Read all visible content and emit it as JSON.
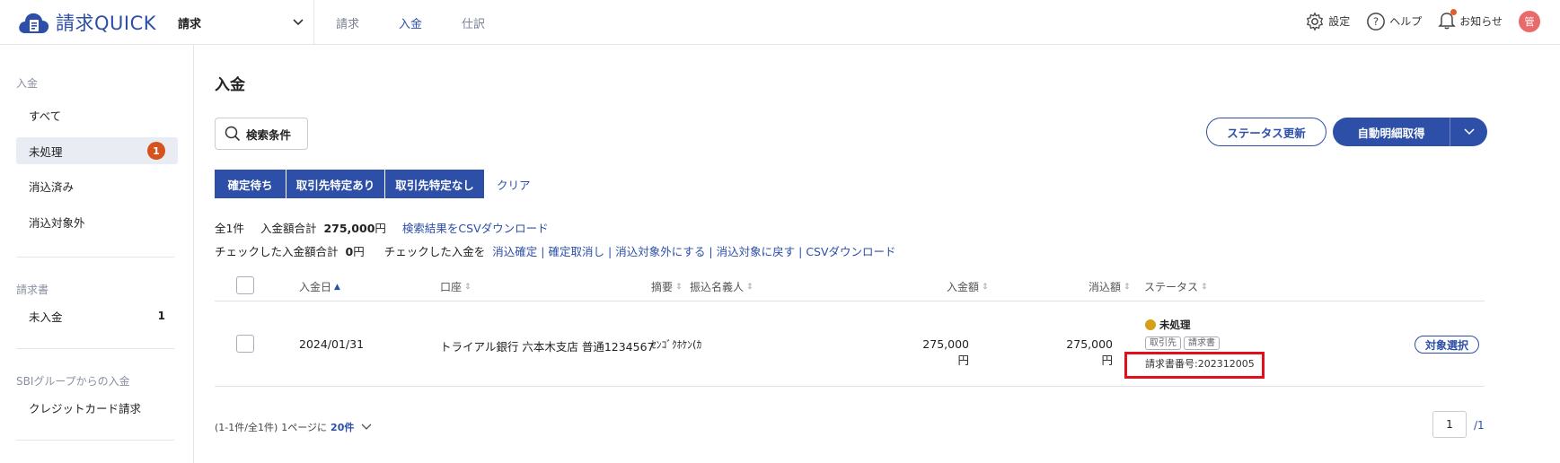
{
  "header": {
    "logo_text": "請求QUICK",
    "product_select": "請求",
    "nav": [
      {
        "label": "請求"
      },
      {
        "label": "入金"
      },
      {
        "label": "仕訳"
      }
    ],
    "settings_label": "設定",
    "help_label": "ヘルプ",
    "notifications_label": "お知らせ",
    "avatar_text": "管"
  },
  "sidebar": {
    "section1_title": "入金",
    "items": [
      {
        "label": "すべて"
      },
      {
        "label": "未処理",
        "badge": "1"
      },
      {
        "label": "消込済み"
      },
      {
        "label": "消込対象外"
      }
    ],
    "section2_title": "請求書",
    "invoice_items": [
      {
        "label": "未入金",
        "count": "1"
      }
    ],
    "section3_title": "SBIグループからの入金",
    "sbi_items": [
      {
        "label": "クレジットカード請求"
      }
    ]
  },
  "main": {
    "title": "入金",
    "search_label": "検索条件",
    "status_update_label": "ステータス更新",
    "auto_fetch_label": "自動明細取得",
    "filters": [
      {
        "label": "確定待ち"
      },
      {
        "label": "取引先特定あり"
      },
      {
        "label": "取引先特定なし"
      }
    ],
    "clear_label": "クリア",
    "summary": {
      "total_count": "全1件",
      "total_amount_label": "入金額合計",
      "total_amount": "275,000",
      "yen": "円",
      "csv_download_results": "検索結果をCSVダウンロード",
      "checked_amount_label": "チェックした入金額合計",
      "checked_amount": "0",
      "checked_action_label": "チェックした入金を",
      "actions": [
        "消込確定",
        "確定取消し",
        "消込対象外にする",
        "消込対象に戻す",
        "CSVダウンロード"
      ]
    },
    "table": {
      "headers": {
        "date": "入金日",
        "account": "口座",
        "memo": "摘要",
        "payer": "振込名義人",
        "amount": "入金額",
        "cleared": "消込額",
        "status": "ステータス"
      },
      "rows": [
        {
          "date": "2024/01/31",
          "account": "トライアル銀行 六本木支店 普通1234567",
          "payer": "ｾﾝｺﾞｸﾎｹﾝ(ｶ",
          "amount": "275,000円",
          "cleared": "275,000円",
          "status": "未処理",
          "tags": [
            "取引先",
            "請求書"
          ],
          "invoice_no": "請求書番号:202312005",
          "action_label": "対象選択"
        }
      ]
    },
    "pagination": {
      "range_text": "(1-1件/全1件)",
      "per_page_label": "1ページに",
      "per_page_value": "20件",
      "current_page": "1",
      "total_pages": "/1"
    }
  },
  "colors": {
    "brand": "#2d4fa8",
    "badge": "#d4531e",
    "status_pending": "#d4a017",
    "highlight_border": "#e0101c"
  }
}
